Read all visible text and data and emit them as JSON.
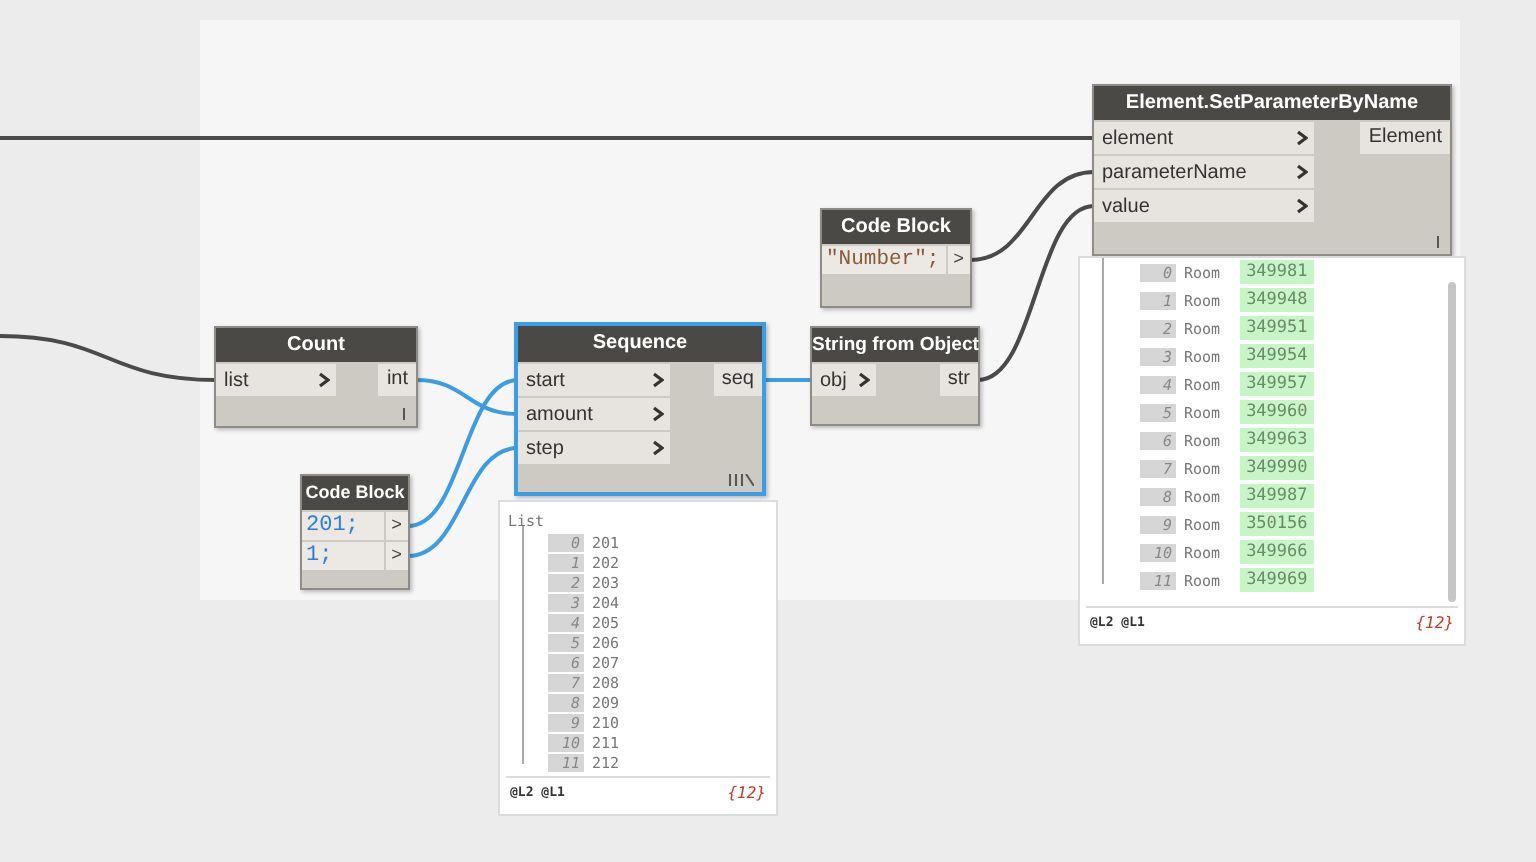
{
  "nodes": [
    {
      "kind": "function",
      "title": "Element.SetParameterByName",
      "selected": false,
      "inputs": [
        "element",
        "parameterName",
        "value"
      ],
      "outputs": [
        "Element"
      ],
      "preview": {
        "scrollbar": true,
        "items": [
          {
            "index": "0",
            "type": "Room",
            "value": "349981"
          },
          {
            "index": "1",
            "type": "Room",
            "value": "349948"
          },
          {
            "index": "2",
            "type": "Room",
            "value": "349951"
          },
          {
            "index": "3",
            "type": "Room",
            "value": "349954"
          },
          {
            "index": "4",
            "type": "Room",
            "value": "349957"
          },
          {
            "index": "5",
            "type": "Room",
            "value": "349960"
          },
          {
            "index": "6",
            "type": "Room",
            "value": "349963"
          },
          {
            "index": "7",
            "type": "Room",
            "value": "349990"
          },
          {
            "index": "8",
            "type": "Room",
            "value": "349987"
          },
          {
            "index": "9",
            "type": "Room",
            "value": "350156"
          },
          {
            "index": "10",
            "type": "Room",
            "value": "349966"
          },
          {
            "index": "11",
            "type": "Room",
            "value": "349969"
          }
        ],
        "levels": "@L2 @L1",
        "count": "{12}"
      }
    },
    {
      "kind": "code",
      "title": "Code Block",
      "selected": false,
      "lines": [
        {
          "text": "\"Number\";",
          "kind": "string",
          "output": ">"
        }
      ]
    },
    {
      "kind": "function",
      "title": "Count",
      "selected": false,
      "inputs": [
        "list"
      ],
      "outputs": [
        "int"
      ]
    },
    {
      "kind": "function",
      "title": "Sequence",
      "selected": true,
      "inputs": [
        "start",
        "amount",
        "step"
      ],
      "outputs": [
        "seq"
      ],
      "preview": {
        "scrollbar": false,
        "header": "List",
        "items": [
          {
            "index": "0",
            "value": "201"
          },
          {
            "index": "1",
            "value": "202"
          },
          {
            "index": "2",
            "value": "203"
          },
          {
            "index": "3",
            "value": "204"
          },
          {
            "index": "4",
            "value": "205"
          },
          {
            "index": "5",
            "value": "206"
          },
          {
            "index": "6",
            "value": "207"
          },
          {
            "index": "7",
            "value": "208"
          },
          {
            "index": "8",
            "value": "209"
          },
          {
            "index": "9",
            "value": "210"
          },
          {
            "index": "10",
            "value": "211"
          },
          {
            "index": "11",
            "value": "212"
          }
        ],
        "levels": "@L2 @L1",
        "count": "{12}"
      }
    },
    {
      "kind": "function",
      "title": "String from Object",
      "selected": false,
      "inputs": [
        "obj"
      ],
      "outputs": [
        "str"
      ]
    },
    {
      "kind": "code",
      "title": "Code Block",
      "selected": false,
      "lines": [
        {
          "text": "201;",
          "kind": "number",
          "output": ">"
        },
        {
          "text": "1;",
          "kind": "number",
          "output": ">"
        }
      ]
    }
  ]
}
